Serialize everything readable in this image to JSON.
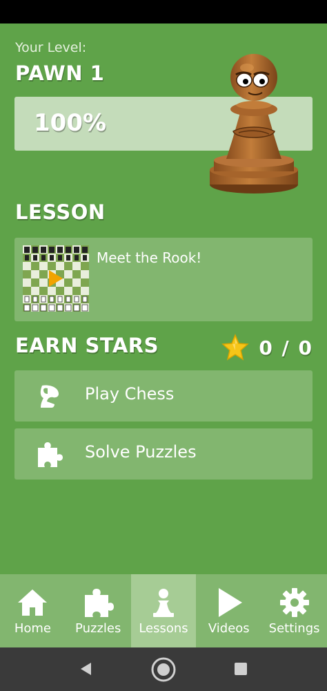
{
  "level": {
    "label": "Your Level:",
    "name": "PAWN 1",
    "progress_text": "100%",
    "progress_fraction": 1.0
  },
  "lesson": {
    "section_title": "LESSON",
    "title": "Meet the Rook!"
  },
  "earn_stars": {
    "section_title": "EARN STARS",
    "count": "0 / 0"
  },
  "actions": [
    {
      "label": "Play Chess",
      "icon": "knight-icon"
    },
    {
      "label": "Solve Puzzles",
      "icon": "puzzle-icon"
    }
  ],
  "nav": [
    {
      "label": "Home",
      "icon": "home-icon"
    },
    {
      "label": "Puzzles",
      "icon": "puzzle-icon"
    },
    {
      "label": "Lessons",
      "icon": "pawn-icon",
      "active": true
    },
    {
      "label": "Videos",
      "icon": "play-icon"
    },
    {
      "label": "Settings",
      "icon": "gear-icon"
    }
  ],
  "colors": {
    "background": "#5fa349",
    "card": "#82b66f",
    "progress_track": "#c4dcba",
    "nav_active": "#a6cc95",
    "star": "#f5c518"
  }
}
